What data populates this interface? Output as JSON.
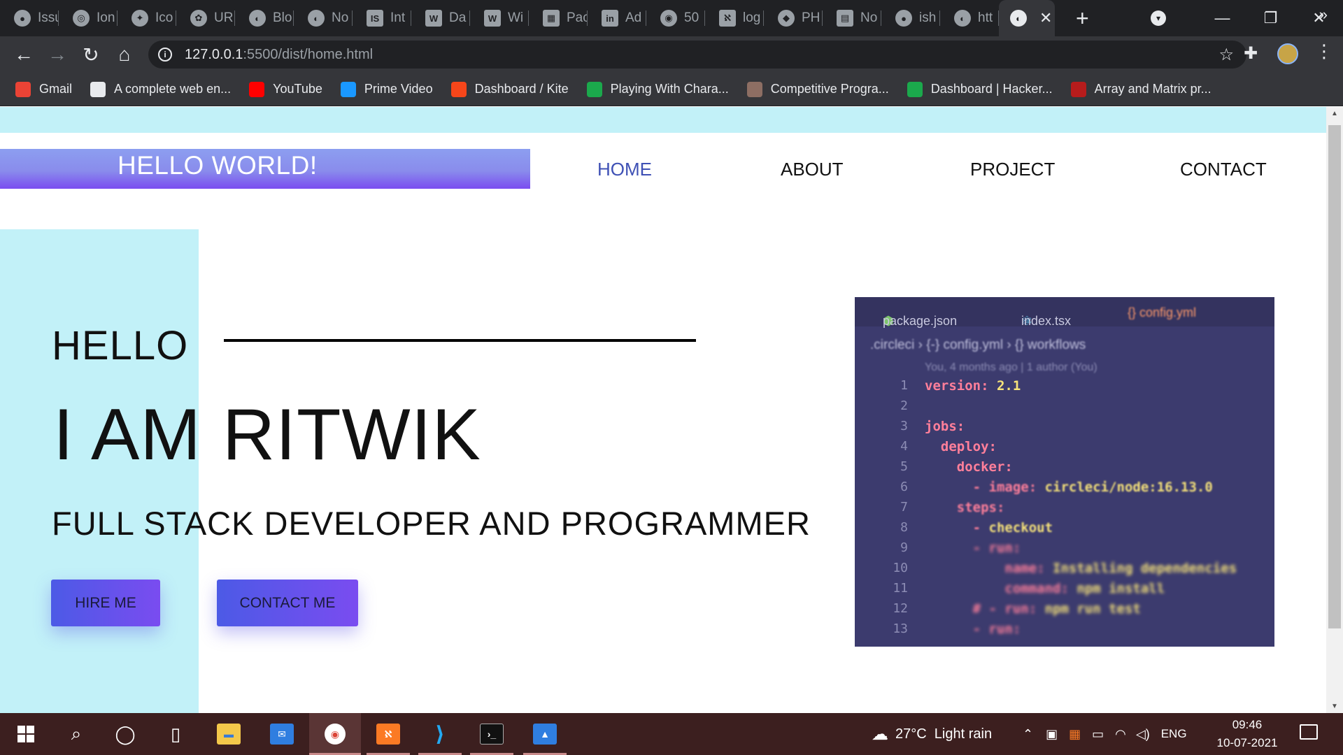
{
  "browser": {
    "tabs": [
      {
        "label": "Issu",
        "icon": "github-icon"
      },
      {
        "label": "Ion",
        "icon": "ionic-icon"
      },
      {
        "label": "Ico",
        "icon": "iconscout-icon"
      },
      {
        "label": "URL",
        "icon": "cat-icon"
      },
      {
        "label": "Blo",
        "icon": "globe-icon"
      },
      {
        "label": "No",
        "icon": "globe-icon"
      },
      {
        "label": "Int",
        "icon": "is-icon"
      },
      {
        "label": "Da",
        "icon": "wix-icon"
      },
      {
        "label": "Wi",
        "icon": "wix-icon"
      },
      {
        "label": "Pac",
        "icon": "package-icon"
      },
      {
        "label": "Ad",
        "icon": "linkedin-icon"
      },
      {
        "label": "50",
        "icon": "chrome-icon"
      },
      {
        "label": "log",
        "icon": "xampp-icon"
      },
      {
        "label": "PH",
        "icon": "shield-icon"
      },
      {
        "label": "No",
        "icon": "doc-icon"
      },
      {
        "label": "ish",
        "icon": "github-icon"
      },
      {
        "label": "htt",
        "icon": "globe-icon"
      }
    ],
    "active_tab_close": "✕",
    "new_tab": "+",
    "url_host": "127.0.0.1",
    "url_rest": ":5500/dist/home.html",
    "bookmarks": [
      {
        "label": "Gmail",
        "icon": "gmail-icon",
        "color": "#ea4335"
      },
      {
        "label": "A complete web en...",
        "icon": "globe-icon",
        "color": "#e8eaed"
      },
      {
        "label": "YouTube",
        "icon": "youtube-icon",
        "color": "#ff0000"
      },
      {
        "label": "Prime Video",
        "icon": "prime-video-icon",
        "color": "#1a98ff"
      },
      {
        "label": "Dashboard / Kite",
        "icon": "kite-icon",
        "color": "#f6461a"
      },
      {
        "label": "Playing With Chara...",
        "icon": "hackerrank-icon",
        "color": "#1ba94c"
      },
      {
        "label": "Competitive Progra...",
        "icon": "codechef-icon",
        "color": "#8d6e63"
      },
      {
        "label": "Dashboard | Hacker...",
        "icon": "hackerrank-icon",
        "color": "#1ba94c"
      },
      {
        "label": "Array and Matrix pr...",
        "icon": "bookmark-icon",
        "color": "#b71c1c"
      }
    ],
    "more": "»"
  },
  "page": {
    "logo": "HELLO WORLD!",
    "nav": {
      "home": "HOME",
      "about": "ABOUT",
      "project": "PROJECT",
      "contact": "CONTACT"
    },
    "hero": {
      "hello": "HELLO",
      "name": "I AM RITWIK",
      "role": "FULL STACK DEVELOPER AND PROGRAMMER",
      "hire_button": "HIRE ME",
      "contact_button": "CONTACT ME"
    },
    "code_image": {
      "tab1": "package.json",
      "tab2": "index.tsx",
      "tab3": "{} config.yml",
      "breadcrumb": ".circleci › {-} config.yml › {} workflows",
      "blame": "You, 4 months ago | 1 author (You)",
      "line_numbers": [
        "1",
        "2",
        "3",
        "4",
        "5",
        "6",
        "7",
        "8",
        "9",
        "10",
        "11",
        "12",
        "13"
      ],
      "lines": [
        {
          "key": "version:",
          "val": " 2.1"
        },
        {
          "key": "",
          "val": ""
        },
        {
          "key": "jobs:",
          "val": ""
        },
        {
          "key": "  deploy:",
          "val": ""
        },
        {
          "key": "    docker:",
          "val": ""
        },
        {
          "key": "      - image:",
          "val": " circleci/node:16.13.0"
        },
        {
          "key": "    steps:",
          "val": ""
        },
        {
          "key": "      - ",
          "val": "checkout"
        },
        {
          "key": "      - run:",
          "val": ""
        },
        {
          "key": "          name:",
          "val": " Installing dependencies"
        },
        {
          "key": "          command:",
          "val": " npm install"
        },
        {
          "key": "      # - run:",
          "val": " npm run test"
        },
        {
          "key": "      - run:",
          "val": ""
        }
      ]
    }
  },
  "taskbar": {
    "weather": "27°C  Light rain",
    "language": "ENG",
    "time": "09:46",
    "date": "10-07-2021"
  },
  "colors": {
    "accent_gradient_start": "#4c5ae6",
    "accent_gradient_end": "#7a4cf0",
    "light_cyan": "#c2f1f8",
    "nav_active": "#3f51b5"
  }
}
